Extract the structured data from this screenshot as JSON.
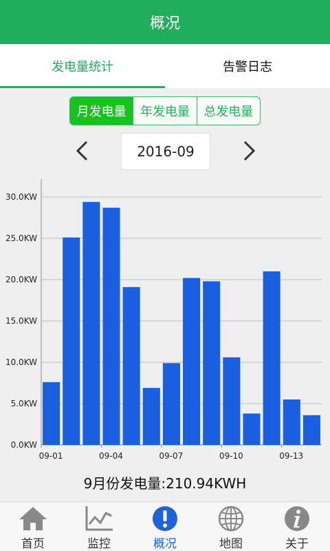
{
  "header": {
    "title": "概况"
  },
  "tabs": [
    {
      "label": "发电量统计",
      "active": true
    },
    {
      "label": "告警日志",
      "active": false
    }
  ],
  "period_selector": [
    {
      "label": "月发电量",
      "active": true
    },
    {
      "label": "年发电量",
      "active": false
    },
    {
      "label": "总发电量",
      "active": false
    }
  ],
  "date_picker": {
    "value": "2016-09",
    "prev_icon": "chevron-left-icon",
    "next_icon": "chevron-right-icon"
  },
  "chart_data": {
    "type": "bar",
    "categories": [
      "09-01",
      "09-02",
      "09-03",
      "09-04",
      "09-05",
      "09-06",
      "09-07",
      "09-08",
      "09-09",
      "09-10",
      "09-11",
      "09-12",
      "09-13",
      "09-14"
    ],
    "x_tick_labels": [
      "09-01",
      "09-04",
      "09-07",
      "09-10",
      "09-13"
    ],
    "values": [
      7.6,
      25.1,
      29.4,
      28.7,
      19.1,
      6.9,
      9.9,
      20.2,
      19.8,
      10.6,
      3.8,
      21.0,
      5.5,
      3.6
    ],
    "y_tick_labels": [
      "0.0KW",
      "5.0KW",
      "10.0KW",
      "15.0KW",
      "20.0KW",
      "25.0KW",
      "30.0KW"
    ],
    "ylim": [
      0,
      30
    ],
    "grid": true,
    "bar_color": "#1a5fe0",
    "grid_color": "#bdbdbd",
    "axis_color": "#888888"
  },
  "summary": {
    "text": "9月份发电量:210.94KWH"
  },
  "bottom_nav": [
    {
      "label": "首页",
      "icon": "home-icon",
      "active": false
    },
    {
      "label": "监控",
      "icon": "line-chart-icon",
      "active": false
    },
    {
      "label": "概况",
      "icon": "info-icon",
      "active": true
    },
    {
      "label": "地图",
      "icon": "globe-icon",
      "active": false
    },
    {
      "label": "关于",
      "icon": "about-icon",
      "active": false
    }
  ],
  "colors": {
    "brand_green": "#20ad5c",
    "segment_active": "#19c21f",
    "nav_active": "#1e63d8"
  }
}
